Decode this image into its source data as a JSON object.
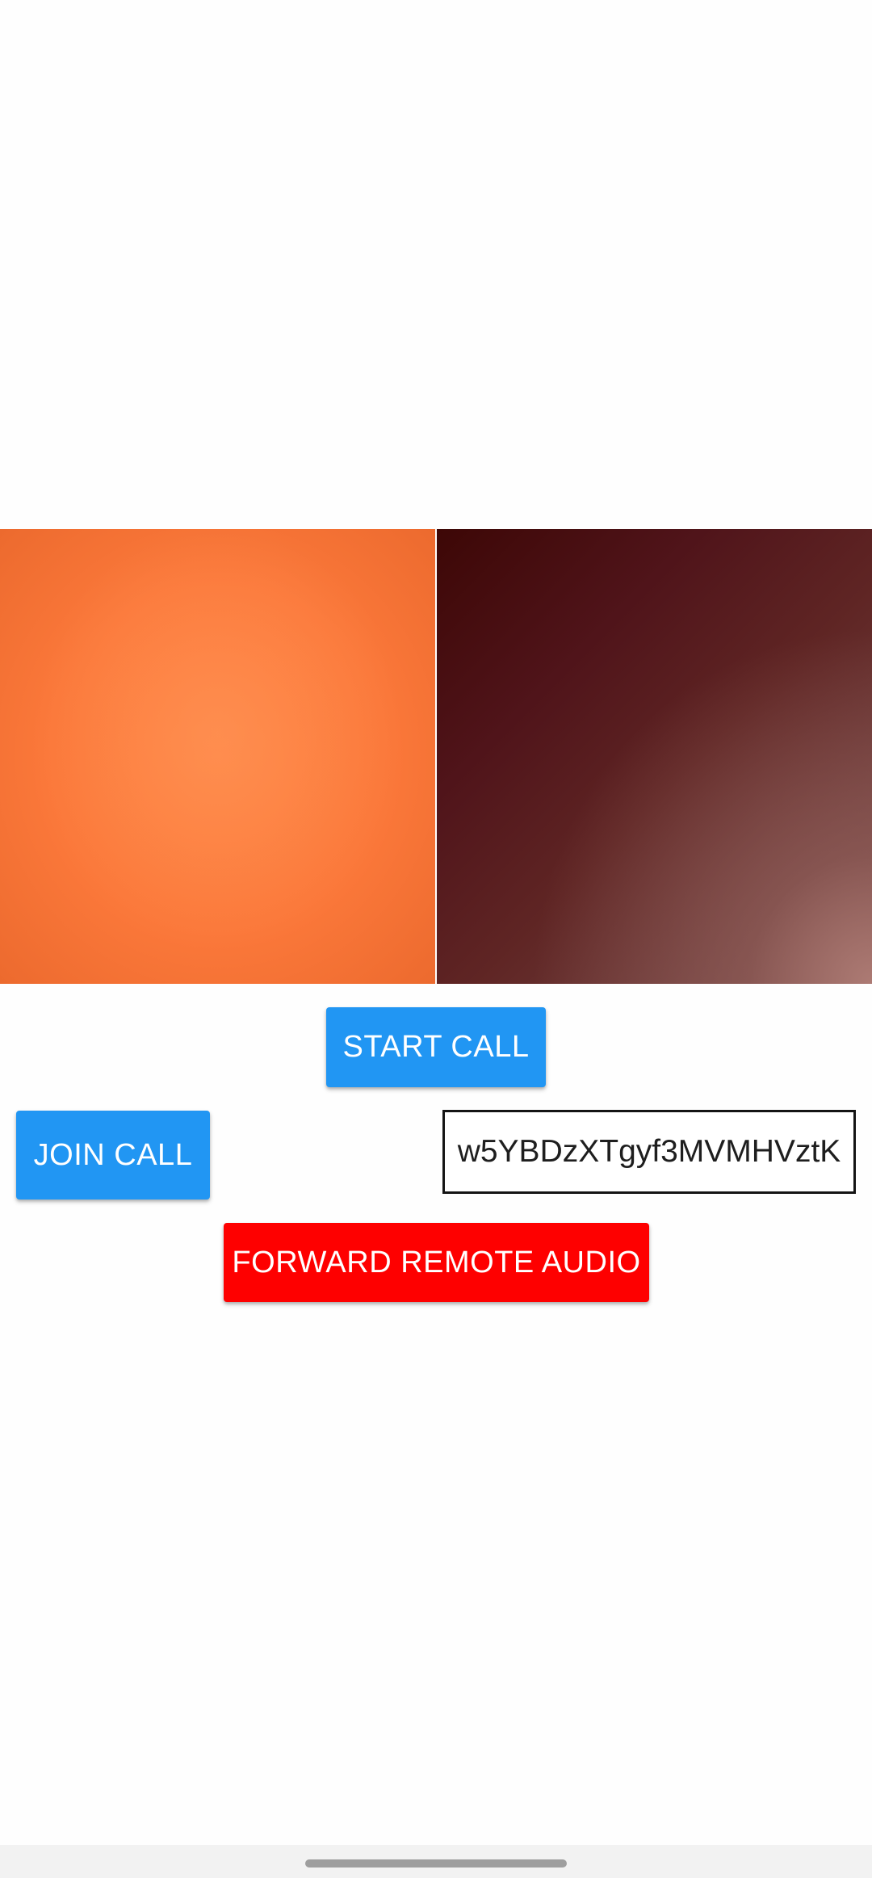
{
  "videos": {
    "local_label": "",
    "remote_label": ""
  },
  "buttons": {
    "start_call": "START CALL",
    "join_call": "JOIN CALL",
    "forward_remote_audio": "FORWARD REMOTE AUDIO"
  },
  "call_id_field": {
    "value": "w5YBDzXTgyf3MVMHVztK"
  },
  "colors": {
    "primary_button": "#2196f3",
    "danger_button": "#fe0000",
    "local_video_tint": "#fb783a",
    "remote_video_tint": "#50141a"
  }
}
